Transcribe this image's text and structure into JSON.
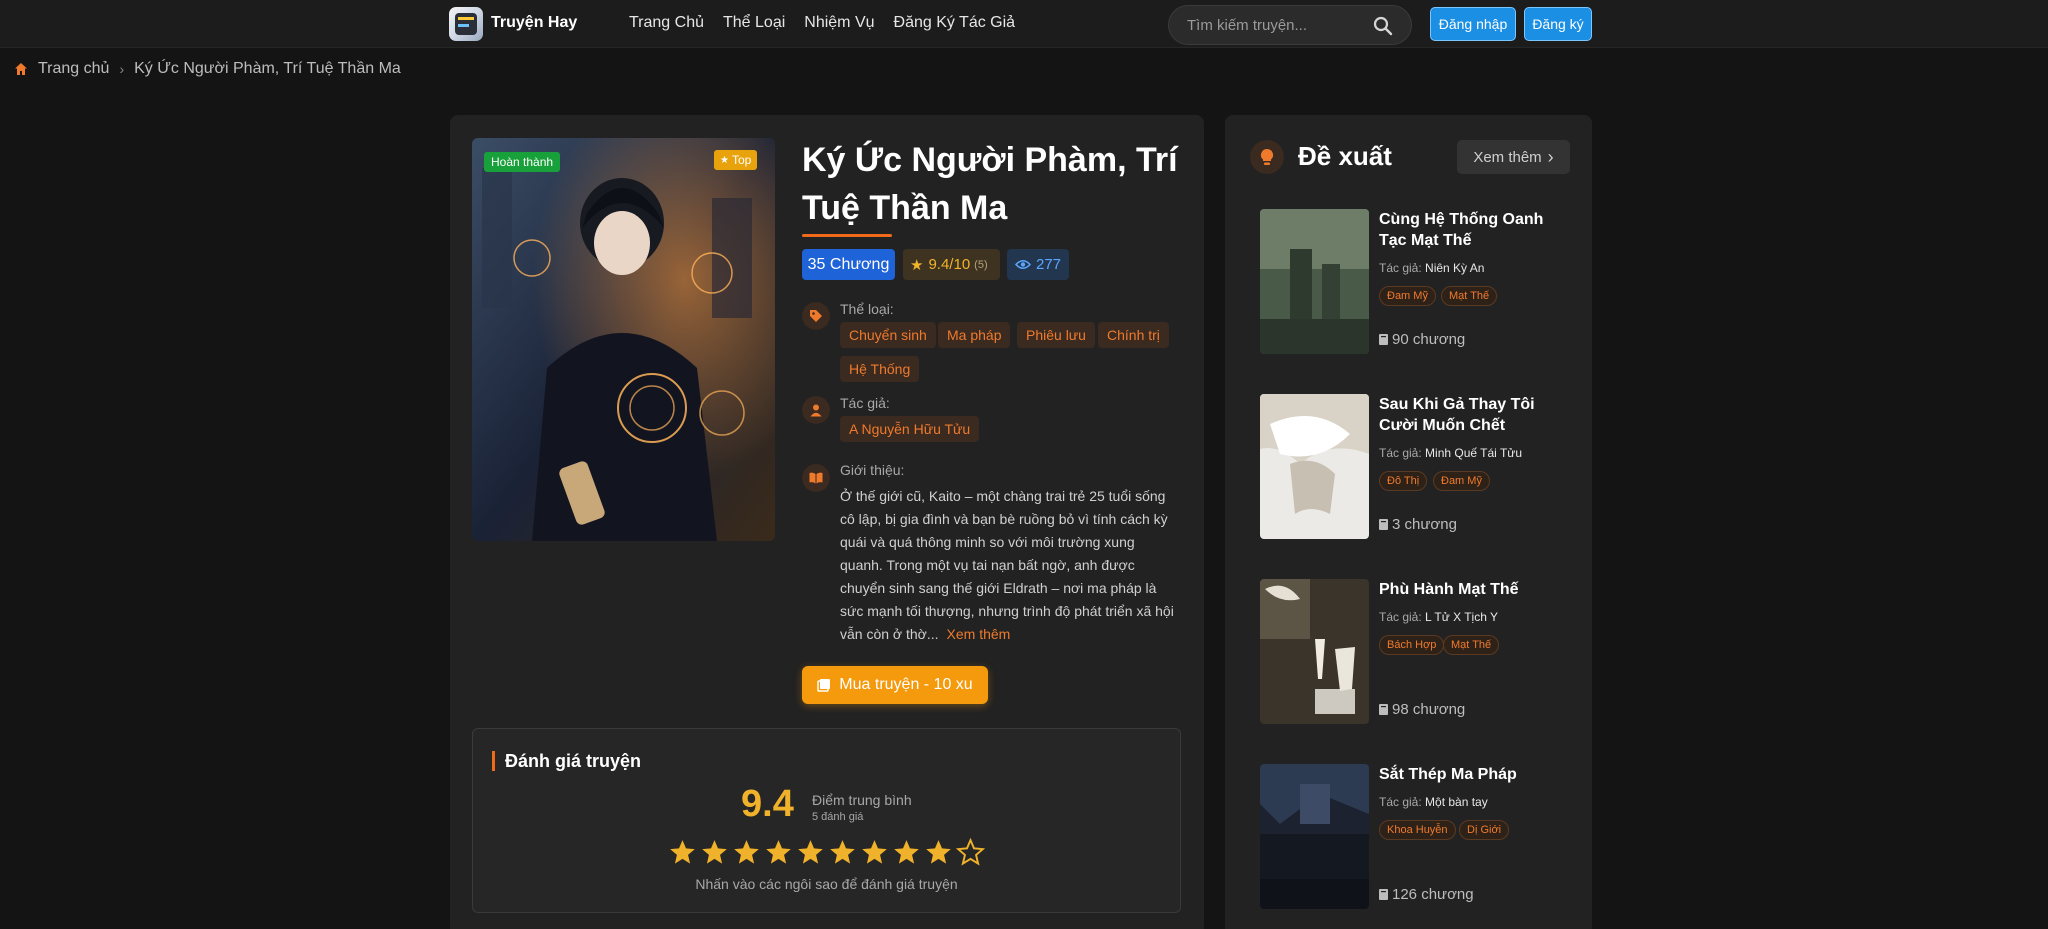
{
  "header": {
    "brand": "Truyện Hay",
    "nav": [
      "Trang Chủ",
      "Thể Loại",
      "Nhiệm Vụ",
      "Đăng Ký Tác Giả"
    ],
    "search_placeholder": "Tìm kiếm truyện...",
    "login": "Đăng nhập",
    "register": "Đăng ký"
  },
  "breadcrumb": {
    "home": "Trang chủ",
    "current": "Ký Ức Người Phàm, Trí Tuệ Thần Ma"
  },
  "story": {
    "status_badge": "Hoàn thành",
    "top_badge": "Top",
    "title": "Ký Ức Người Phàm, Trí Tuệ Thần Ma",
    "chapters": "35 Chương",
    "rating": "9.4/10",
    "rating_count": "(5)",
    "views": "277",
    "genre_label": "Thể loại:",
    "genres": [
      "Chuyển sinh",
      "Ma pháp",
      "Phiêu lưu",
      "Chính trị",
      "Hệ Thống"
    ],
    "author_label": "Tác giả:",
    "author": "A Nguyễn Hữu Tửu",
    "intro_label": "Giới thiệu:",
    "intro": "Ở thế giới cũ, Kaito – một chàng trai trẻ 25 tuổi sống cô lập, bị gia đình và bạn bè ruồng bỏ vì tính cách kỳ quái và quá thông minh so với môi trường xung quanh. Trong một vụ tai nạn bất ngờ, anh được chuyển sinh sang thế giới Eldrath – nơi ma pháp là sức mạnh tối thượng, nhưng trình độ phát triển xã hội vẫn còn ở thờ...",
    "read_more": "Xem thêm",
    "buy_button": "Mua truyện - 10 xu"
  },
  "rating_section": {
    "title": "Đánh giá truyện",
    "score": "9.4",
    "score_label": "Điểm trung bình",
    "count_label": "5 đánh giá",
    "stars_filled": 9,
    "stars_total": 10,
    "hint": "Nhấn vào các ngôi sao để đánh giá truyện"
  },
  "sidebar": {
    "title": "Đề xuất",
    "see_more": "Xem thêm",
    "author_prefix": "Tác giả:",
    "items": [
      {
        "title": "Cùng Hệ Thống Oanh Tạc Mạt Thế",
        "author": "Niên Kỳ An",
        "tags": [
          "Đam Mỹ",
          "Mạt Thế"
        ],
        "chapters": "90 chương"
      },
      {
        "title": "Sau Khi Gả Thay Tôi Cười Muốn Chết",
        "author": "Minh Quế Tái Tửu",
        "tags": [
          "Đô Thị",
          "Đam Mỹ"
        ],
        "chapters": "3 chương"
      },
      {
        "title": "Phù Hành Mạt Thế",
        "author": "L Tử X Tịch Y",
        "tags": [
          "Bách Hợp",
          "Mạt Thế"
        ],
        "chapters": "98 chương"
      },
      {
        "title": "Sắt Thép Ma Pháp",
        "author": "Một bàn tay",
        "tags": [
          "Khoa Huyễn",
          "Dị Giới"
        ],
        "chapters": "126 chương"
      }
    ]
  },
  "colors": {
    "accent": "#f06a1a",
    "brand_blue": "#1a8fe3",
    "star": "#f0b22a"
  }
}
